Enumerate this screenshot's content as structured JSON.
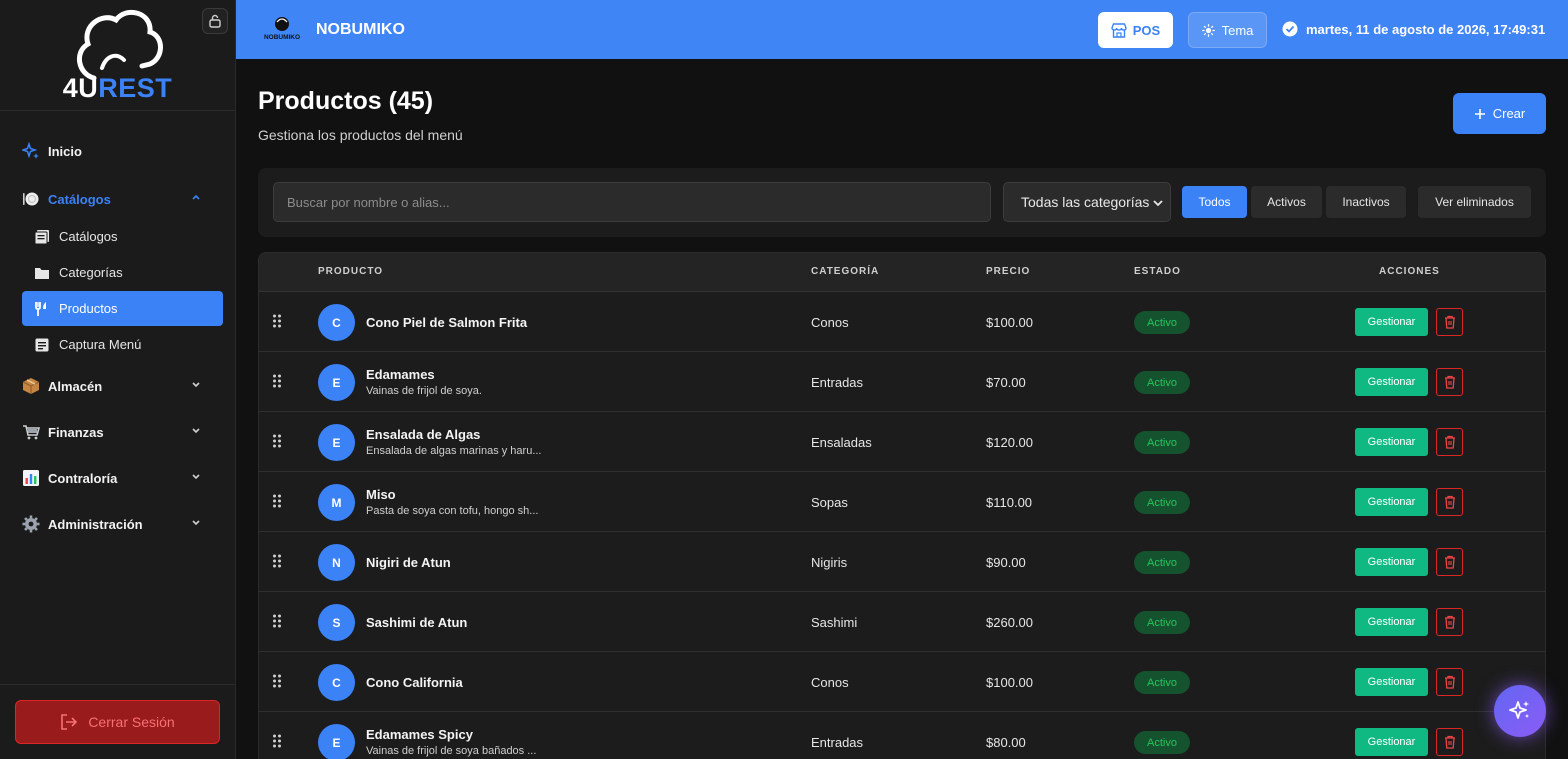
{
  "app": {
    "logo_text_primary": "4U",
    "logo_text_accent": "REST",
    "restaurant_logo_text": "NOBUMIKO",
    "restaurant_name": "NOBUMIKO",
    "datetime": "martes, 11 de agosto de 2026, 17:49:31"
  },
  "topbar": {
    "pos_label": "POS",
    "theme_label": "Tema"
  },
  "sidebar": {
    "inicio": "Inicio",
    "catalogos_group": "Catálogos",
    "sub_items": [
      "Catálogos",
      "Categorías",
      "Productos",
      "Captura Menú"
    ],
    "almacen": "Almacén",
    "finanzas": "Finanzas",
    "contraloria": "Contraloría",
    "administracion": "Administración",
    "logout_label": "Cerrar Sesión"
  },
  "page": {
    "title": "Productos (45)",
    "subtitle": "Gestiona los productos del menú",
    "create_label": "Crear"
  },
  "filters": {
    "search_placeholder": "Buscar por nombre o alias...",
    "category_selected": "Todas las categorías",
    "status_buttons": [
      "Todos",
      "Activos",
      "Inactivos"
    ],
    "active_status": "Todos",
    "deleted_label": "Ver eliminados"
  },
  "table": {
    "headers": [
      "PRODUCTO",
      "CATEGORÍA",
      "PRECIO",
      "ESTADO",
      "ACCIONES"
    ],
    "manage_label": "Gestionar",
    "rows": [
      {
        "initial": "C",
        "name": "Cono Piel de Salmon Frita",
        "description": "",
        "category": "Conos",
        "price": "$100.00",
        "status": "Activo"
      },
      {
        "initial": "E",
        "name": "Edamames",
        "description": "Vainas de frijol de soya.",
        "category": "Entradas",
        "price": "$70.00",
        "status": "Activo"
      },
      {
        "initial": "E",
        "name": "Ensalada de Algas",
        "description": "Ensalada de algas marinas y haru...",
        "category": "Ensaladas",
        "price": "$120.00",
        "status": "Activo"
      },
      {
        "initial": "M",
        "name": "Miso",
        "description": "Pasta de soya con tofu, hongo sh...",
        "category": "Sopas",
        "price": "$110.00",
        "status": "Activo"
      },
      {
        "initial": "N",
        "name": "Nigiri de Atun",
        "description": "",
        "category": "Nigiris",
        "price": "$90.00",
        "status": "Activo"
      },
      {
        "initial": "S",
        "name": "Sashimi de Atun",
        "description": "",
        "category": "Sashimi",
        "price": "$260.00",
        "status": "Activo"
      },
      {
        "initial": "C",
        "name": "Cono California",
        "description": "",
        "category": "Conos",
        "price": "$100.00",
        "status": "Activo"
      },
      {
        "initial": "E",
        "name": "Edamames Spicy",
        "description": "Vainas de frijol de soya bañados ...",
        "category": "Entradas",
        "price": "$80.00",
        "status": "Activo"
      }
    ]
  },
  "colors": {
    "accent": "#3b82f6",
    "topbar": "#4085f5",
    "success": "#10b981",
    "danger": "#dc2626",
    "background": "#111111"
  },
  "icons": {
    "sidebar": [
      "sparkle-icon",
      "plate-icon",
      "catalog-icon",
      "folder-icon",
      "utensils-icon",
      "menu-list-icon",
      "box-icon",
      "cart-icon",
      "chart-icon",
      "gear-icon"
    ],
    "actions": [
      "drag-handle-icon",
      "trash-icon",
      "plus-icon",
      "logout-icon",
      "store-icon",
      "sun-icon",
      "check-circle-icon",
      "ai-sparkle-icon",
      "lock-icon"
    ]
  }
}
